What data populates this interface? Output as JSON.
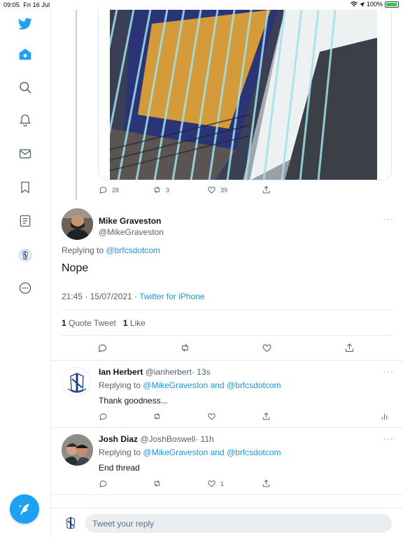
{
  "status_bar": {
    "time": "09:05",
    "date": "Fri 16 Jul",
    "battery": "100%"
  },
  "sidebar": {
    "items": [
      {
        "icon": "twitter-bird-icon",
        "label": "Twitter"
      },
      {
        "icon": "home-icon",
        "label": "Home"
      },
      {
        "icon": "search-icon",
        "label": "Explore"
      },
      {
        "icon": "bell-icon",
        "label": "Notifications"
      },
      {
        "icon": "mail-icon",
        "label": "Messages"
      },
      {
        "icon": "bookmark-icon",
        "label": "Bookmarks"
      },
      {
        "icon": "lists-icon",
        "label": "Lists"
      },
      {
        "icon": "profile-avatar-icon",
        "label": "Profile"
      },
      {
        "icon": "more-circle-icon",
        "label": "More"
      }
    ],
    "compose_icon": "compose-feather-icon",
    "accent": "#1da1f2"
  },
  "parent_tweet": {
    "replies": "28",
    "retweets": "3",
    "likes": "39"
  },
  "main_tweet": {
    "name": "Mike Graveston",
    "handle": "@MikeGraveston",
    "replying_prefix": "Replying to",
    "replying_to": "@brfcsdotcom",
    "text": "Nope",
    "timestamp": "21:45 · 15/07/2021 · ",
    "source": "Twitter for iPhone",
    "quote_count": "1",
    "quote_label": "Quote Tweet",
    "like_count": "1",
    "like_label": "Like"
  },
  "replies": [
    {
      "name": "Ian Herbert",
      "handle": "@ianherbert",
      "time": "· 13s",
      "replying_prefix": "Replying to",
      "replying_to": "@MikeGraveston and @brfcsdotcom",
      "text": "Thank goodness...",
      "likes": ""
    },
    {
      "name": "Josh Diaz",
      "handle": "@JoshBoswell",
      "time": "· 11h",
      "replying_prefix": "Replying to",
      "replying_to": "@MikeGraveston and @brfcsdotcom",
      "text": "End thread",
      "likes": "1"
    }
  ],
  "reply_box": {
    "placeholder": "Tweet your reply"
  },
  "colors": {
    "link": "#1b95e0",
    "muted": "#536471",
    "border": "#e6ecf0"
  }
}
